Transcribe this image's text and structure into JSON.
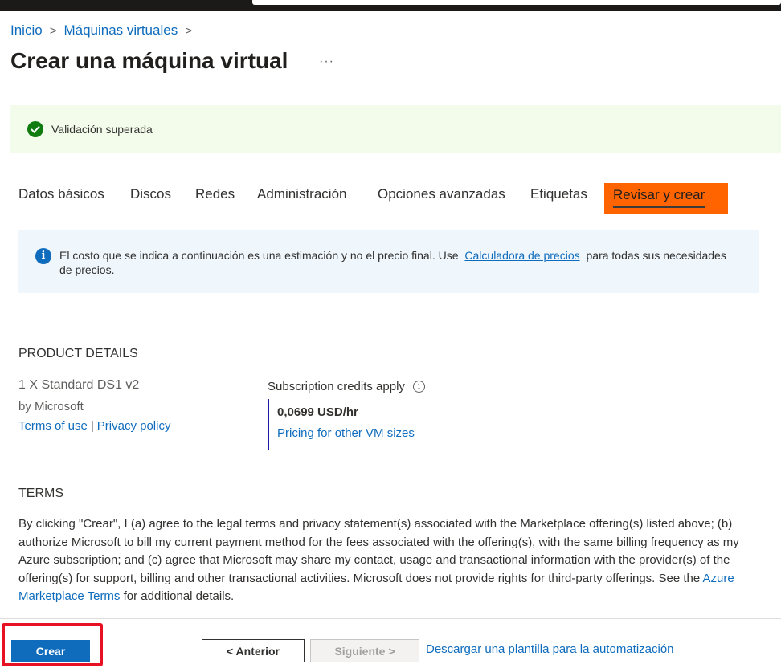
{
  "breadcrumb": {
    "home": "Inicio",
    "parent": "Máquinas virtuales"
  },
  "page": {
    "title": "Crear una máquina virtual",
    "more": "···"
  },
  "validation": {
    "text": "Validación superada"
  },
  "tabs": [
    {
      "label": "Datos básicos"
    },
    {
      "label": "Discos"
    },
    {
      "label": "Redes"
    },
    {
      "label": "Administración"
    },
    {
      "label": "Opciones avanzadas"
    },
    {
      "label": "Etiquetas"
    },
    {
      "label": "Revisar y crear",
      "active": true
    }
  ],
  "info_banner": {
    "text_before": "El costo que se indica a continuación es una estimación y no el precio final. Use",
    "link": "Calculadora de precios",
    "text_after": "para todas sus necesidades de precios."
  },
  "product_details": {
    "heading": "PRODUCT DETAILS",
    "name": "1 X Standard DS1 v2",
    "publisher": "by Microsoft",
    "terms_link": "Terms of use",
    "separator": "|",
    "privacy_link": "Privacy policy",
    "credits_label": "Subscription credits apply",
    "price": "0,0699 USD/hr",
    "pricing_link": "Pricing for other VM sizes"
  },
  "terms": {
    "heading": "TERMS",
    "text_before": "By clicking \"Crear\", I (a) agree to the legal terms and privacy statement(s) associated with the Marketplace offering(s) listed above; (b) authorize Microsoft to bill my current payment method for the fees associated with the offering(s), with the same billing frequency as my Azure subscription; and (c) agree that Microsoft may share my contact, usage and transactional information with the provider(s) of the offering(s) for support, billing and other transactional activities. Microsoft does not provide rights for third-party offerings. See the",
    "link": "Azure Marketplace Terms",
    "text_after": "for additional details."
  },
  "footer": {
    "create": "Crear",
    "previous": "< Anterior",
    "next": "Siguiente >",
    "download": "Descargar una plantilla para la automatización"
  },
  "colors": {
    "link": "#0f6cbd",
    "active_tab_highlight": "#ff6400",
    "annotation_outline": "#e81123",
    "success": "#107c10"
  }
}
